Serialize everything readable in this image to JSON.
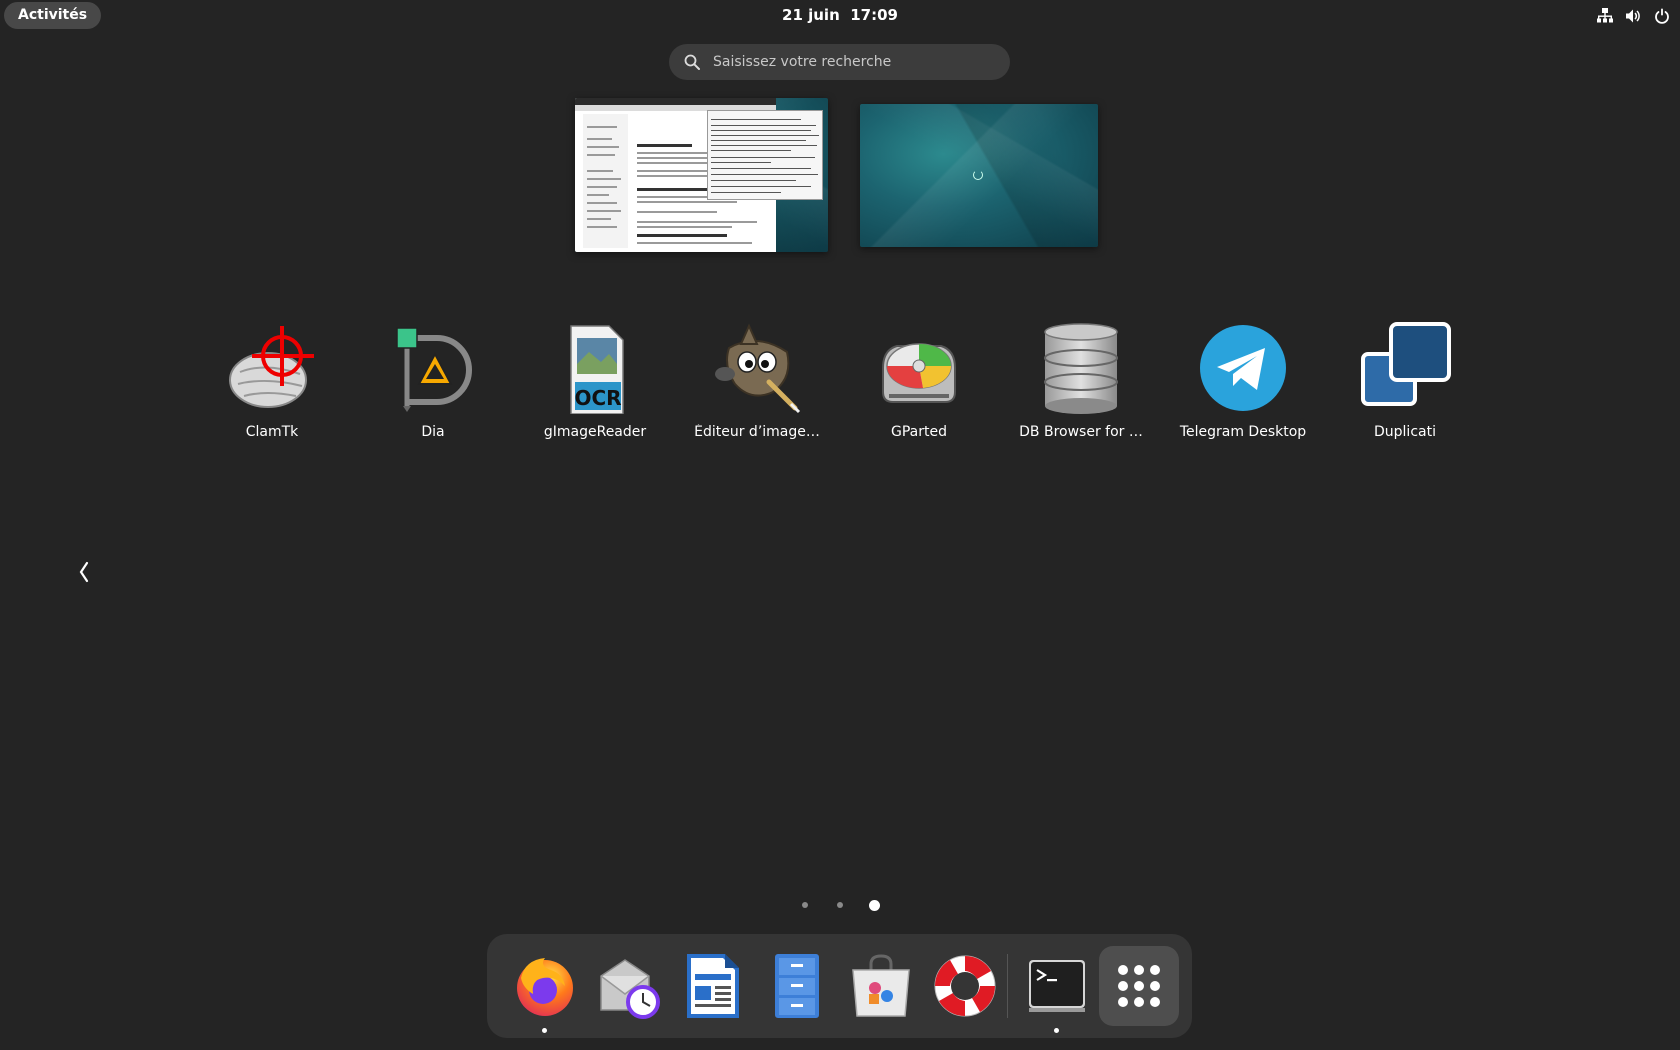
{
  "topbar": {
    "activities": "Activités",
    "date": "21 juin",
    "time": "17:09",
    "tray_icons": [
      "network-icon",
      "volume-icon",
      "power-icon"
    ]
  },
  "search": {
    "placeholder": "Saisissez votre recherche"
  },
  "workspaces": [
    {
      "name": "workspace-1",
      "contents": [
        "browser-window",
        "terminal-window"
      ]
    },
    {
      "name": "workspace-2",
      "contents": []
    }
  ],
  "apps": [
    {
      "label": "ClamTk",
      "icon": "clamtk-icon"
    },
    {
      "label": "Dia",
      "icon": "dia-icon"
    },
    {
      "label": "gImageReader",
      "icon": "gimagereader-icon",
      "icon_text": "OCR"
    },
    {
      "label": "Éditeur d’image…",
      "icon": "gimp-icon"
    },
    {
      "label": "GParted",
      "icon": "gparted-icon"
    },
    {
      "label": "DB Browser for …",
      "icon": "db-browser-icon"
    },
    {
      "label": "Telegram Desktop",
      "icon": "telegram-icon"
    },
    {
      "label": "Duplicati",
      "icon": "duplicati-icon"
    }
  ],
  "pager": {
    "pages": 3,
    "current": 3
  },
  "dash": {
    "items": [
      {
        "name": "firefox",
        "icon": "firefox-icon",
        "running": true
      },
      {
        "name": "evolution",
        "icon": "mail-clock-icon",
        "running": false
      },
      {
        "name": "libreoffice-writer",
        "icon": "writer-icon",
        "running": false
      },
      {
        "name": "files",
        "icon": "file-cabinet-icon",
        "running": false
      },
      {
        "name": "software",
        "icon": "software-bag-icon",
        "running": false
      },
      {
        "name": "help",
        "icon": "lifebuoy-icon",
        "running": false
      },
      {
        "name": "terminal",
        "icon": "terminal-icon",
        "running": true
      },
      {
        "name": "show-apps",
        "icon": "app-grid-icon",
        "running": false
      }
    ]
  },
  "colors": {
    "background": "#242424",
    "dash": "#353535",
    "search": "#3c3c3c",
    "activities": "#484848"
  }
}
